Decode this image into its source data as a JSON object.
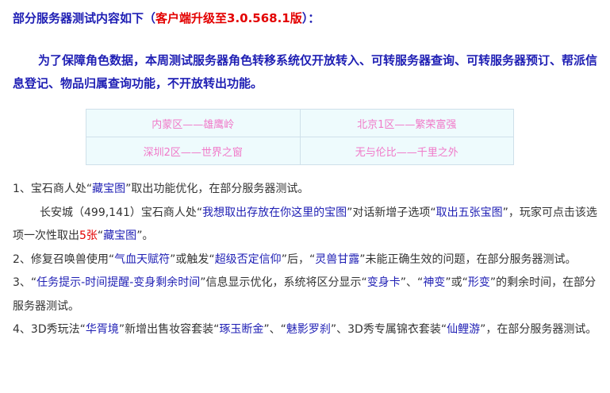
{
  "heading": {
    "prefix": "部分服务器测试内容如下（",
    "version": "客户端升级至3.0.568.1版",
    "suffix": "）："
  },
  "intro": "为了保障角色数据，本周测试服务器角色转移系统仅开放转入、可转服务器查询、可转服务器预订、帮派信息登记、物品归属查询功能，不开放转出功能。",
  "servers": {
    "row1": {
      "left": "内蒙区——雄鹰岭",
      "right": "北京1区——繁荣富强"
    },
    "row2": {
      "left": "深圳2区——世界之窗",
      "right": "无与伦比——千里之外"
    }
  },
  "items": {
    "item1": {
      "p1": "1、宝石商人处“",
      "h1": "藏宝图",
      "p2": "”取出功能优化，在部分服务器测试。"
    },
    "item1_detail": {
      "p1": "长安城（499,141）宝石商人处“",
      "h1": "我想取出存放在你这里的宝图",
      "p2": "”对话新增子选项“",
      "h2": "取出五张宝图",
      "p3": "”，玩家可点击该选项一次性取出",
      "count": "5张",
      "p4": "“",
      "h3": "藏宝图",
      "p5": "”。"
    },
    "item2": {
      "p1": "2、修复召唤兽使用“",
      "h1": "气血天赋符",
      "p2": "”或触发“",
      "h2": "超级否定信仰",
      "p3": "”后，“",
      "h3": "灵兽甘露",
      "p4": "”未能正确生效的问题，在部分服务器测试。"
    },
    "item3": {
      "p1": "3、“",
      "h1": "任务提示-时间提醒-变身剩余时间",
      "p2": "”信息显示优化，系统将区分显示“",
      "h2": "变身卡",
      "p3": "”、“",
      "h3": "神变",
      "p4": "”或“",
      "h4": "形变",
      "p5": "”的剩余时间，在部分服务器测试。"
    },
    "item4": {
      "p1": "4、3D秀玩法“",
      "h1": "华胥境",
      "p2": "”新增出售妆容套装“",
      "h2": "琢玉断金",
      "p3": "”、“",
      "h3": "魅影罗刹",
      "p4": "”、3D秀专属锦衣套装“",
      "h4": "仙鲤游",
      "p5": "”，在部分服务器测试。"
    }
  },
  "colors": {
    "highlight_blue": "#1f1fb4",
    "highlight_red": "#e30000",
    "server_pink": "#f07ac9",
    "table_bg": "#eefbfd"
  }
}
